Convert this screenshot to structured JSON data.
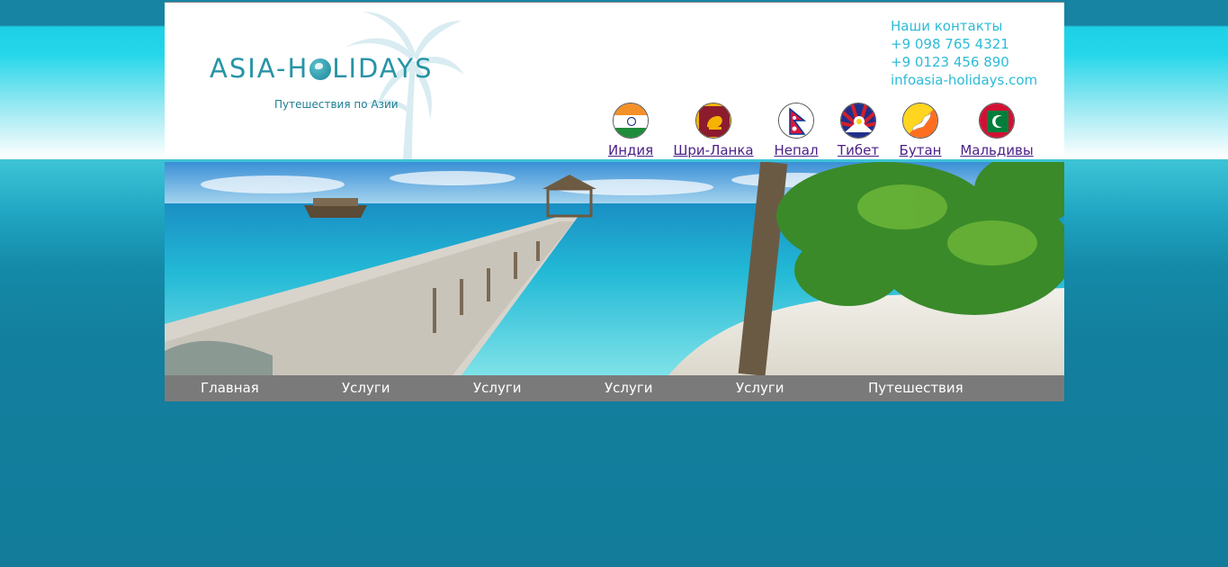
{
  "site": {
    "logo": "ASIA-H",
    "logo_tail": "LIDAYS",
    "tagline": "Путешествия по Азии"
  },
  "contacts": {
    "title": "Наши контакты",
    "phone1": "+9 098 765 4321",
    "phone2": "+9 0123 456 890",
    "email": "infoasia-holidays.com"
  },
  "countries": [
    {
      "label": "Индия",
      "icon": "india-flag-icon"
    },
    {
      "label": "Шри-Ланка",
      "icon": "sri-lanka-flag-icon"
    },
    {
      "label": "Непал",
      "icon": "nepal-flag-icon"
    },
    {
      "label": "Тибет",
      "icon": "tibet-flag-icon"
    },
    {
      "label": "Бутан",
      "icon": "bhutan-flag-icon"
    },
    {
      "label": "Мальдивы",
      "icon": "maldives-flag-icon"
    }
  ],
  "nav": {
    "items": [
      "Главная",
      "Услуги",
      "Услуги",
      "Услуги",
      "Услуги",
      "Путешествия"
    ]
  },
  "colors": {
    "accent": "#2794a6",
    "contacts": "#2dbbd6",
    "link": "#4b1f86",
    "nav_bg": "#7a7a7a",
    "page_bg": "#137f9e"
  }
}
